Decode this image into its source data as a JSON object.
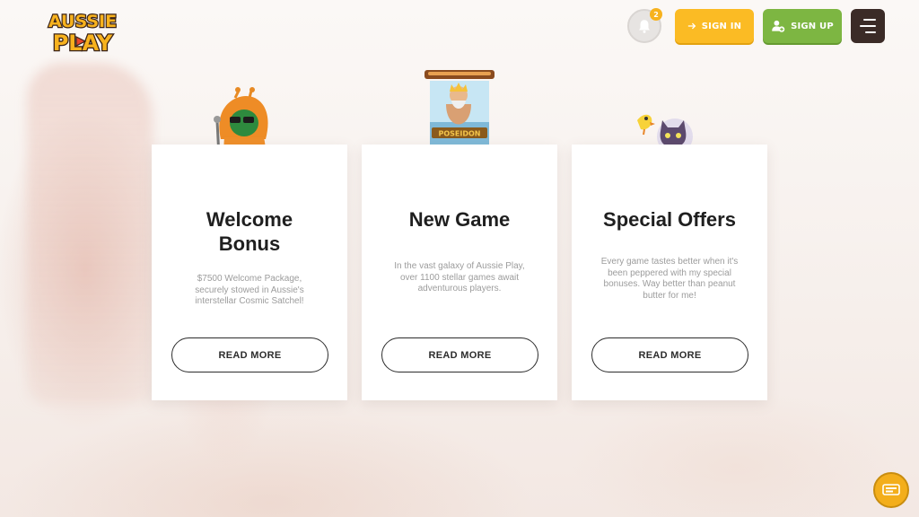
{
  "header": {
    "logo_top": "AUSSIE",
    "logo_bottom": "PLAY",
    "notification_count": "2",
    "signin_label": "SIGN IN",
    "signup_label": "SIGN UP"
  },
  "cards": [
    {
      "title": "Welcome Bonus",
      "description": "$7500 Welcome Package, securely stowed in Aussie's interstellar Cosmic Satchel!",
      "button": "READ MORE",
      "icon": "alien-mascot-icon"
    },
    {
      "title": "New Game",
      "description": "In the vast galaxy of Aussie Play, over 1100 stellar games await adventurous players.",
      "button": "READ MORE",
      "icon": "poseidon-hologram-icon",
      "game_label": "POSEIDON"
    },
    {
      "title": "Special Offers",
      "description": "Every game tastes better when it's been peppered with my special bonuses. Way better than peanut butter for me!",
      "button": "READ MORE",
      "icon": "cat-mascot-icon"
    }
  ],
  "colors": {
    "signin": "#fbbb24",
    "signup": "#7db642",
    "menu": "#3b2b27",
    "chat": "#f3ae1b"
  },
  "icons": {
    "bell": "bell-icon",
    "signin": "arrow-right-icon",
    "signup": "add-user-icon",
    "menu": "hamburger-menu-icon",
    "chat": "chat-icon"
  }
}
